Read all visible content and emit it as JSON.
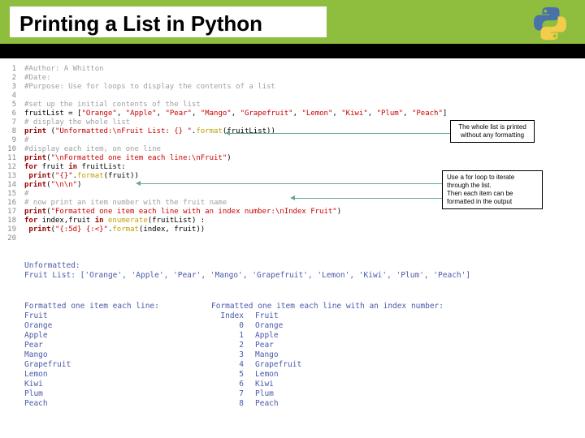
{
  "title": "Printing a List in Python",
  "logo_name": "python-logo",
  "code": {
    "lines": [
      {
        "n": 1,
        "cls": "com",
        "t": "#Author: A Whitton"
      },
      {
        "n": 2,
        "cls": "com",
        "t": "#Date:"
      },
      {
        "n": 3,
        "cls": "com",
        "t": "#Purpose: Use for loops to display the contents of a list"
      },
      {
        "n": 4,
        "cls": "",
        "t": ""
      },
      {
        "n": 5,
        "cls": "com",
        "t": "#set up the initial contents of the list"
      },
      {
        "n": 6,
        "cls": "",
        "t": "fruitList = [\"Orange\", \"Apple\", \"Pear\", \"Mango\", \"Grapefruit\", \"Lemon\", \"Kiwi\", \"Plum\", \"Peach\"]"
      },
      {
        "n": 7,
        "cls": "com",
        "t": "# display the whole list"
      },
      {
        "n": 8,
        "cls": "",
        "t": "print (\"Unformatted:\\nFruit List: {} \".format(fruitList))"
      },
      {
        "n": 9,
        "cls": "com",
        "t": "#"
      },
      {
        "n": 10,
        "cls": "com",
        "t": "#display each item, on one line"
      },
      {
        "n": 11,
        "cls": "",
        "t": "print(\"\\nFormatted one item each line:\\nFruit\")"
      },
      {
        "n": 12,
        "cls": "",
        "t": "for fruit in fruitList:"
      },
      {
        "n": 13,
        "cls": "",
        "t": "    print(\"{}\".format(fruit))"
      },
      {
        "n": 14,
        "cls": "",
        "t": "print(\"\\n\\n\")"
      },
      {
        "n": 15,
        "cls": "com",
        "t": "#"
      },
      {
        "n": 16,
        "cls": "com",
        "t": "# now print an item number with the fruit name"
      },
      {
        "n": 17,
        "cls": "",
        "t": "print(\"Formatted one item each line with an index number:\\nIndex  Fruit\")"
      },
      {
        "n": 18,
        "cls": "",
        "t": "for index,fruit in enumerate(fruitList) :"
      },
      {
        "n": 19,
        "cls": "",
        "t": "    print(\"{:5d}  {:<}\".format(index, fruit))"
      },
      {
        "n": 20,
        "cls": "",
        "t": ""
      }
    ]
  },
  "callouts": {
    "c1": "The whole list is printed without any formatting",
    "c2": "Use a for loop to iterate through the list.\nThen each item can be formatted in the output"
  },
  "output": {
    "block1": {
      "l1": "Unformatted:",
      "l2": "Fruit List: ['Orange', 'Apple', 'Pear', 'Mango', 'Grapefruit', 'Lemon', 'Kiwi', 'Plum', 'Peach']"
    },
    "block2": {
      "header": "Formatted one item each line:",
      "sub": "Fruit",
      "items": [
        "Orange",
        "Apple",
        "Pear",
        "Mango",
        "Grapefruit",
        "Lemon",
        "Kiwi",
        "Plum",
        "Peach"
      ]
    },
    "block3": {
      "header": "Formatted one item each line with an index number:",
      "idx_label": "Index",
      "fruit_label": "Fruit",
      "rows": [
        {
          "i": 0,
          "f": "Orange"
        },
        {
          "i": 1,
          "f": "Apple"
        },
        {
          "i": 2,
          "f": "Pear"
        },
        {
          "i": 3,
          "f": "Mango"
        },
        {
          "i": 4,
          "f": "Grapefruit"
        },
        {
          "i": 5,
          "f": "Lemon"
        },
        {
          "i": 6,
          "f": "Kiwi"
        },
        {
          "i": 7,
          "f": "Plum"
        },
        {
          "i": 8,
          "f": "Peach"
        }
      ]
    }
  }
}
